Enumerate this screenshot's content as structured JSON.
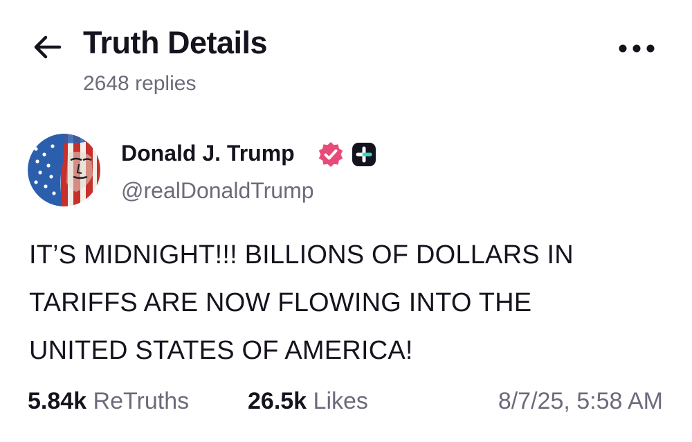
{
  "header": {
    "title": "Truth Details",
    "replies_text": "2648 replies",
    "back_icon": "arrow-left-icon",
    "more_icon": "more-horizontal-icon"
  },
  "post": {
    "author_name": "Donald J. Trump",
    "author_handle": "@realDonaldTrump",
    "verified_color": "#e94b79",
    "plus_badge_color": "#14141f",
    "text": "IT’S MIDNIGHT!!! BILLIONS OF DOLLARS IN\nTARIFFS ARE NOW FLOWING INTO THE\nUNITED STATES OF AMERICA!",
    "stats": {
      "retruths_count": "5.84k",
      "retruths_label": "ReTruths",
      "likes_count": "26.5k",
      "likes_label": "Likes"
    },
    "timestamp": "8/7/25, 5:58 AM"
  },
  "colors": {
    "text_primary": "#14141f",
    "text_secondary": "#6b6b7b",
    "background": "#ffffff"
  }
}
